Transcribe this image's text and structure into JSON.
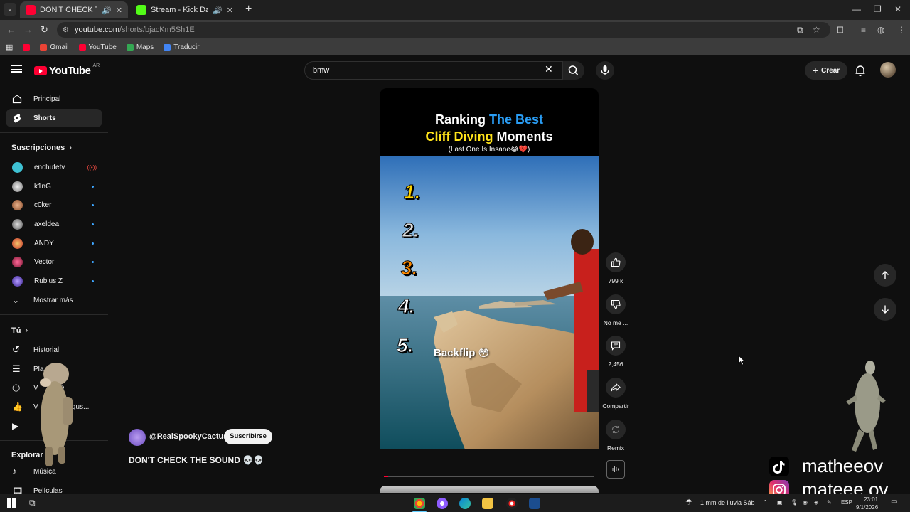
{
  "browser": {
    "tabs": [
      {
        "title": "DON'T CHECK THE SOUND",
        "active": true,
        "favicon_color": "#ff0033"
      },
      {
        "title": "Stream - Kick Dashboard",
        "active": false,
        "favicon_color": "#53fc18"
      }
    ],
    "new_tab": "+",
    "url_host": "youtube.com",
    "url_path": "/shorts/bjacKm5Sh1E",
    "bookmarks": [
      {
        "label": "Gmail",
        "icon_color": "#ea4335"
      },
      {
        "label": "YouTube",
        "icon_color": "#ff0033"
      },
      {
        "label": "Maps",
        "icon_color": "#34a853"
      },
      {
        "label": "Traducir",
        "icon_color": "#4285f4"
      }
    ]
  },
  "header": {
    "logo_text": "YouTube",
    "country_code": "AR",
    "search_value": "bmw",
    "create_label": "Crear"
  },
  "sidebar": {
    "main": [
      {
        "label": "Principal",
        "icon": "home-icon"
      },
      {
        "label": "Shorts",
        "icon": "shorts-icon",
        "selected": true
      }
    ],
    "subscriptions_header": "Suscripciones",
    "subscriptions": [
      {
        "label": "enchufetv",
        "color": "#3ec1d3",
        "live": true
      },
      {
        "label": "k1nG",
        "color": "#dddddd"
      },
      {
        "label": "c0ker",
        "color": "#c9855a"
      },
      {
        "label": "axeldea",
        "color": "#bbbbbb"
      },
      {
        "label": "ANDY",
        "color": "#e05a3a"
      },
      {
        "label": "Vector",
        "color": "#c72c5b"
      },
      {
        "label": "Rubius Z",
        "color": "#6a4ad8"
      }
    ],
    "show_more": "Mostrar más",
    "you_header": "Tú",
    "you_items": [
      {
        "label": "Historial",
        "icon": "history-icon"
      },
      {
        "label": "Pla",
        "icon": "playlist-icon"
      },
      {
        "label": "V      arde",
        "icon": "clock-icon"
      },
      {
        "label": "V      ue me gus...",
        "icon": "like-icon"
      },
      {
        "label": "         os",
        "icon": "video-icon"
      }
    ],
    "explore_header": "Explorar",
    "explore_items": [
      {
        "label": "Música",
        "icon": "music-icon"
      },
      {
        "label": "Películas",
        "icon": "film-icon"
      }
    ]
  },
  "short": {
    "title_line1_a": "Ranking ",
    "title_line1_b": "The Best",
    "title_line2_a": "Cliff Diving",
    "title_line2_b": " Moments",
    "subtitle": "(Last One Is Insane😂💔)",
    "ranks": [
      "1.",
      "2.",
      "3.",
      "4.",
      "5."
    ],
    "rank5_label": "Backflip 😳",
    "progress": 0.02,
    "channel": "@RealSpookyCactus",
    "subscribe_label": "Suscribirse",
    "video_title": "DON'T CHECK THE SOUND 💀💀"
  },
  "actions": {
    "like_count": "799 k",
    "dislike_label": "No me ...",
    "comments_count": "2,456",
    "share_label": "Compartir",
    "remix_label": "Remix"
  },
  "overlay": {
    "tiktok_handle": "matheeov",
    "instagram_handle": "mateee.ov"
  },
  "taskbar": {
    "weather": "1 mm de lluvia Sáb",
    "language": "ESP",
    "time": "23:01",
    "date": "9/1/2026"
  }
}
